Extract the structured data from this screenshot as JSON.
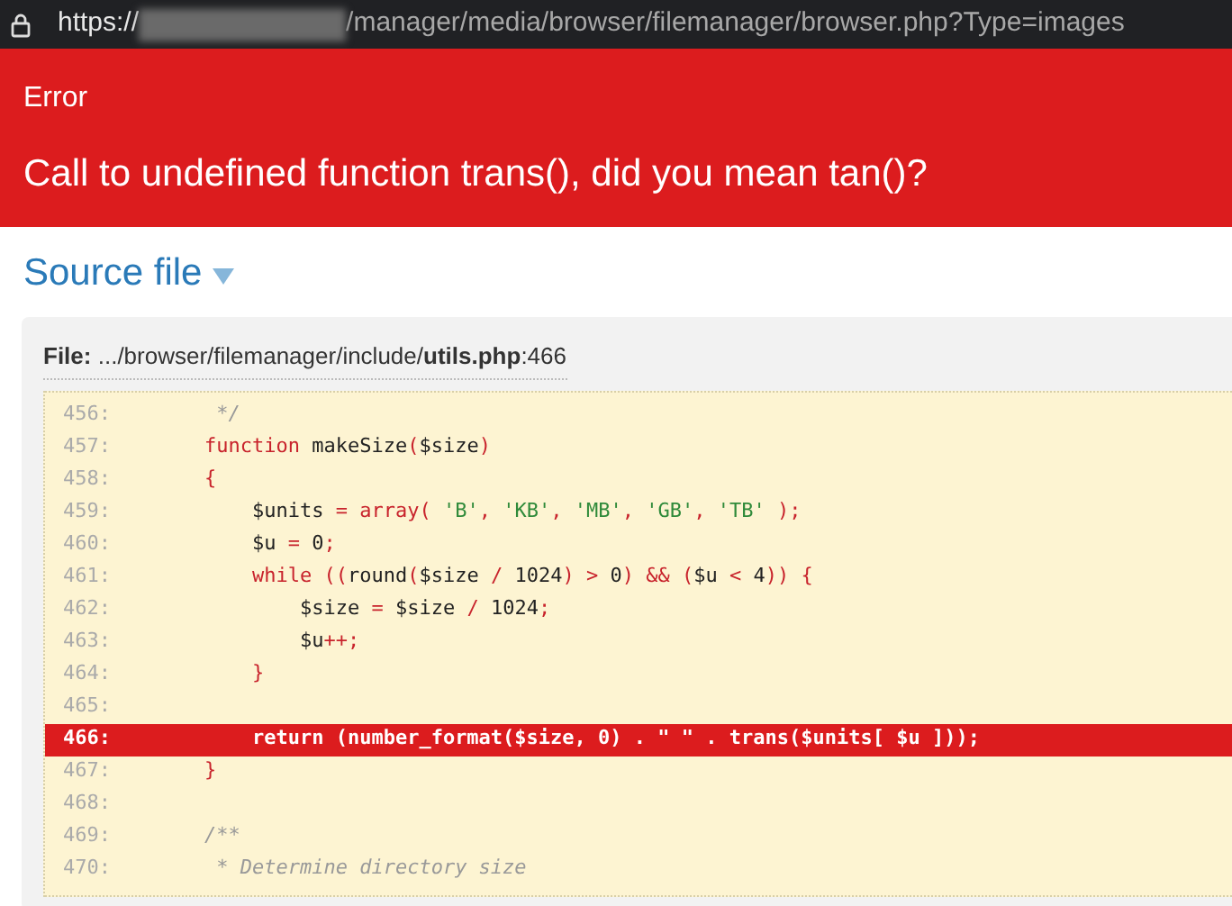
{
  "address_bar": {
    "scheme": "https://",
    "path": "/manager/media/browser/filemanager/browser.php?Type=images"
  },
  "error": {
    "label": "Error",
    "message": "Call to undefined function trans(), did you mean tan()?"
  },
  "source": {
    "heading": "Source file",
    "expanded": true,
    "file": {
      "label": "File:",
      "dir": ".../browser/filemanager/include/",
      "name": "utils.php",
      "line": ":466"
    },
    "lines": [
      {
        "number": "456:",
        "highlighted": false,
        "tokens": [
          {
            "kind": "comment",
            "text": "     */"
          }
        ]
      },
      {
        "number": "457:",
        "highlighted": false,
        "tokens": [
          {
            "kind": "keyword",
            "text": "    function"
          },
          {
            "kind": "plain",
            "text": " makeSize"
          },
          {
            "kind": "keyword",
            "text": "("
          },
          {
            "kind": "plain",
            "text": "$size"
          },
          {
            "kind": "keyword",
            "text": ")"
          }
        ]
      },
      {
        "number": "458:",
        "highlighted": false,
        "tokens": [
          {
            "kind": "keyword",
            "text": "    {"
          }
        ]
      },
      {
        "number": "459:",
        "highlighted": false,
        "tokens": [
          {
            "kind": "plain",
            "text": "        $units "
          },
          {
            "kind": "keyword",
            "text": "= array( "
          },
          {
            "kind": "string",
            "text": "'B'"
          },
          {
            "kind": "keyword",
            "text": ", "
          },
          {
            "kind": "string",
            "text": "'KB'"
          },
          {
            "kind": "keyword",
            "text": ", "
          },
          {
            "kind": "string",
            "text": "'MB'"
          },
          {
            "kind": "keyword",
            "text": ", "
          },
          {
            "kind": "string",
            "text": "'GB'"
          },
          {
            "kind": "keyword",
            "text": ", "
          },
          {
            "kind": "string",
            "text": "'TB'"
          },
          {
            "kind": "keyword",
            "text": " );"
          }
        ]
      },
      {
        "number": "460:",
        "highlighted": false,
        "tokens": [
          {
            "kind": "plain",
            "text": "        $u "
          },
          {
            "kind": "keyword",
            "text": "= "
          },
          {
            "kind": "plain",
            "text": "0"
          },
          {
            "kind": "keyword",
            "text": ";"
          }
        ]
      },
      {
        "number": "461:",
        "highlighted": false,
        "tokens": [
          {
            "kind": "keyword",
            "text": "        while (("
          },
          {
            "kind": "plain",
            "text": "round"
          },
          {
            "kind": "keyword",
            "text": "("
          },
          {
            "kind": "plain",
            "text": "$size "
          },
          {
            "kind": "keyword",
            "text": "/ "
          },
          {
            "kind": "plain",
            "text": "1024"
          },
          {
            "kind": "keyword",
            "text": ") > "
          },
          {
            "kind": "plain",
            "text": "0"
          },
          {
            "kind": "keyword",
            "text": ") && ("
          },
          {
            "kind": "plain",
            "text": "$u "
          },
          {
            "kind": "keyword",
            "text": "< "
          },
          {
            "kind": "plain",
            "text": "4"
          },
          {
            "kind": "keyword",
            "text": ")) {"
          }
        ]
      },
      {
        "number": "462:",
        "highlighted": false,
        "tokens": [
          {
            "kind": "plain",
            "text": "            $size "
          },
          {
            "kind": "keyword",
            "text": "= "
          },
          {
            "kind": "plain",
            "text": "$size "
          },
          {
            "kind": "keyword",
            "text": "/ "
          },
          {
            "kind": "plain",
            "text": "1024"
          },
          {
            "kind": "keyword",
            "text": ";"
          }
        ]
      },
      {
        "number": "463:",
        "highlighted": false,
        "tokens": [
          {
            "kind": "plain",
            "text": "            $u"
          },
          {
            "kind": "keyword",
            "text": "++;"
          }
        ]
      },
      {
        "number": "464:",
        "highlighted": false,
        "tokens": [
          {
            "kind": "keyword",
            "text": "        }"
          }
        ]
      },
      {
        "number": "465:",
        "highlighted": false
      },
      {
        "number": "466:",
        "highlighted": true,
        "tokens": [
          {
            "kind": "plain",
            "text": "        return (number_format($size, 0) . \" \" . trans($units[ $u ]));"
          }
        ]
      },
      {
        "number": "467:",
        "highlighted": false,
        "tokens": [
          {
            "kind": "keyword",
            "text": "    }"
          }
        ]
      },
      {
        "number": "468:",
        "highlighted": false
      },
      {
        "number": "469:",
        "highlighted": false,
        "tokens": [
          {
            "kind": "comment",
            "text": "    /**"
          }
        ]
      },
      {
        "number": "470:",
        "highlighted": false,
        "tokens": [
          {
            "kind": "comment",
            "text": "     * Determine directory size"
          }
        ]
      }
    ]
  }
}
